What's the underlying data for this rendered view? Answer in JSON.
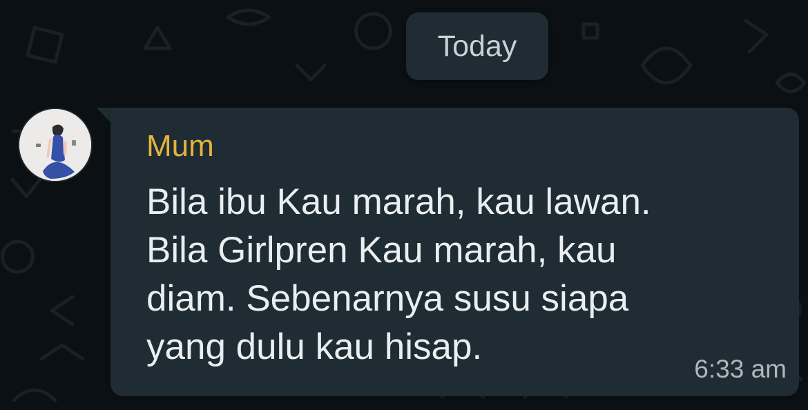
{
  "chat": {
    "date_separator": "Today",
    "message": {
      "sender": "Mum",
      "text": "Bila ibu Kau marah, kau lawan.\nBila Girlpren Kau marah, kau\ndiam. Sebenarnya susu siapa\nyang dulu kau hisap.",
      "time": "6:33 am"
    }
  },
  "theme": {
    "background": "#0b1014",
    "bubble": "#1f2c33",
    "sender_name": "#e5b33e",
    "message_text": "#e9eef0",
    "timestamp": "#aeb7bc"
  },
  "icons": {
    "avatar": "profile-photo-avatar",
    "wallpaper": "chat-doodle-pattern"
  }
}
